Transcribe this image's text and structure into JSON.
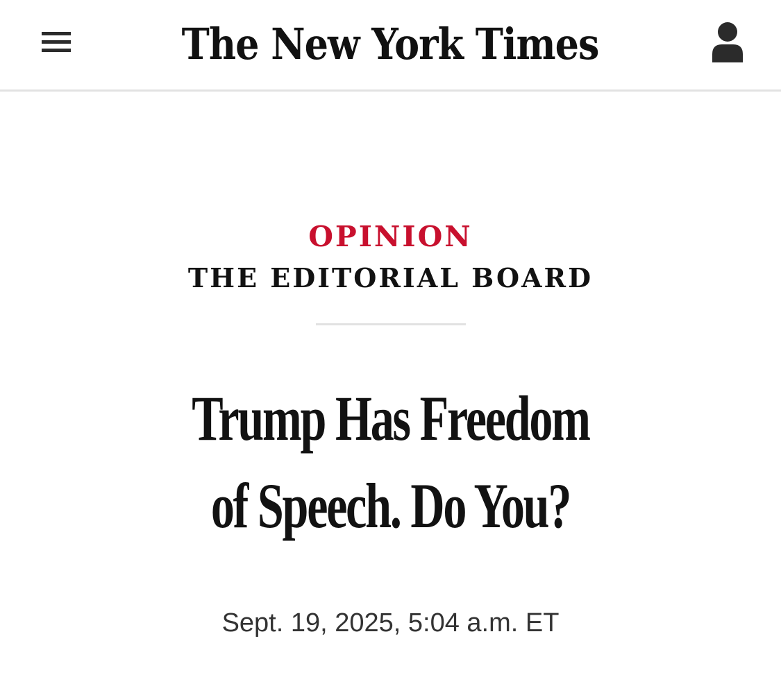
{
  "header": {
    "masthead": "The New York Times",
    "menu_icon": "hamburger-menu-icon",
    "account_icon": "user-account-icon"
  },
  "article": {
    "section": "OPINION",
    "byline": "THE EDITORIAL BOARD",
    "headline_line1": "Trump Has Freedom",
    "headline_line2": "of Speech. Do You?",
    "date": "Sept. 19, 2025, 5:04 a.m. ET"
  },
  "colors": {
    "section_accent": "#c8102e",
    "text": "#121212",
    "divider": "#e2e2e2"
  }
}
